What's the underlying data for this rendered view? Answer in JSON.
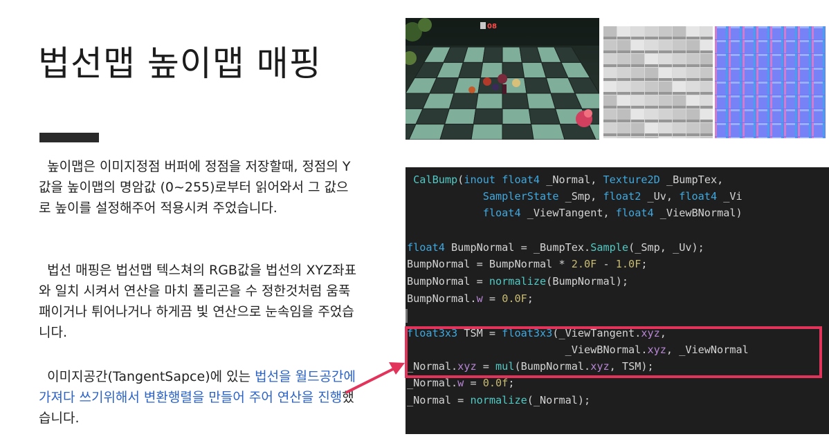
{
  "slide": {
    "title": "법선맵 높이맵 매핑",
    "paragraphs": [
      {
        "text": "  높이맵은 이미지정점 버퍼에 정점을 저장할때, 정점의 Y값을 높이맵의 명암값 (0~255)로부터 읽어와서 그 값으로 높이를 설정해주어 적용시켜 주었습니다."
      },
      {
        "text": "  법선 매핑은 법선맵 텍스쳐의 RGB값을 법선의 XYZ좌표와 일치 시켜서 연산을 마치 폴리곤을 수 정한것처럼 움푹패이거나 튀어나거나 하게끔 빛 연산으로 눈속임을 주었습니다."
      },
      {
        "prefix": "  이미지공간(TangentSapce)에 있는 ",
        "highlight": "법선을 월드공간에 가져다 쓰기위해서 변환행렬을 만들어 주어 연산을 진행",
        "suffix": "했습니다."
      }
    ]
  },
  "images": {
    "game": {
      "hud_text": "08"
    },
    "heightmap": {
      "icon": "heightmap-texture"
    },
    "normalmap": {
      "icon": "normalmap-texture"
    }
  },
  "code": {
    "lines": [
      " CalBump(inout float4 _Normal, Texture2D _BumpTex,",
      "            SamplerState _Smp, float2 _Uv, float4 _Vi",
      "            float4 _ViewTangent, float4 _ViewBNormal)",
      "",
      "float4 BumpNormal = _BumpTex.Sample(_Smp, _Uv);",
      "BumpNormal = BumpNormal * 2.0F - 1.0F;",
      "BumpNormal = normalize(BumpNormal);",
      "BumpNormal.w = 0.0F;",
      "",
      "float3x3 TSM = float3x3(_ViewTangent.xyz,",
      "                         _ViewBNormal.xyz, _ViewNormal",
      "_Normal.xyz = mul(BumpNormal.xyz, TSM);",
      "_Normal.w = 0.0f;",
      "_Normal = normalize(_Normal);"
    ]
  },
  "colors": {
    "highlight_box": "#e2335b",
    "arrow": "#e2335b",
    "link_text": "#2a62c8"
  }
}
